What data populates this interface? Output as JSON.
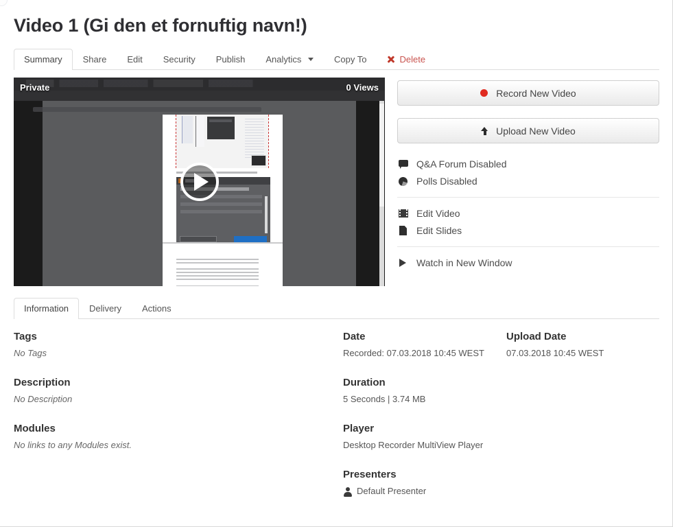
{
  "page": {
    "title": "Video 1 (Gi den et fornuftig navn!)"
  },
  "primary_tabs": [
    {
      "label": "Summary",
      "active": true
    },
    {
      "label": "Share",
      "active": false
    },
    {
      "label": "Edit",
      "active": false
    },
    {
      "label": "Security",
      "active": false
    },
    {
      "label": "Publish",
      "active": false
    },
    {
      "label": "Analytics",
      "active": false,
      "caret": true
    },
    {
      "label": "Copy To",
      "active": false
    },
    {
      "label": "Delete",
      "active": false,
      "danger": true,
      "icon": "delete-x-icon"
    }
  ],
  "player": {
    "privacy_badge": "Private",
    "views_badge": "0 Views",
    "play_icon": "play-icon"
  },
  "actions": {
    "record_button": {
      "label": "Record New Video",
      "icon": "record-dot-icon"
    },
    "upload_button": {
      "label": "Upload New Video",
      "icon": "upload-arrow-icon"
    },
    "groups": [
      {
        "items": [
          {
            "label": "Q&A Forum Disabled",
            "icon": "speech-bubble-icon"
          },
          {
            "label": "Polls Disabled",
            "icon": "pie-chart-icon"
          }
        ]
      },
      {
        "items": [
          {
            "label": "Edit Video",
            "icon": "film-strip-icon"
          },
          {
            "label": "Edit Slides",
            "icon": "document-icon"
          }
        ]
      },
      {
        "items": [
          {
            "label": "Watch in New Window",
            "icon": "play-triangle-icon"
          }
        ]
      }
    ]
  },
  "lower_tabs": [
    {
      "label": "Information",
      "active": true
    },
    {
      "label": "Delivery",
      "active": false
    },
    {
      "label": "Actions",
      "active": false
    }
  ],
  "info": {
    "column_1": [
      {
        "heading": "Tags",
        "value": "No Tags",
        "muted": true
      },
      {
        "heading": "Description",
        "value": "No Description",
        "muted": true
      },
      {
        "heading": "Modules",
        "value": "No links to any Modules exist.",
        "muted": true
      }
    ],
    "column_2": [
      {
        "heading": "Date",
        "value": "Recorded: 07.03.2018 10:45 WEST",
        "muted": false
      },
      {
        "heading": "Duration",
        "value": "5 Seconds | 3.74 MB",
        "muted": false
      },
      {
        "heading": "Player",
        "value": "Desktop Recorder MultiView Player",
        "muted": false
      },
      {
        "heading": "Presenters",
        "value": "Default Presenter",
        "muted": false,
        "icon": "user-icon"
      }
    ],
    "column_3": [
      {
        "heading": "Upload Date",
        "value": "07.03.2018 10:45 WEST",
        "muted": false
      }
    ]
  },
  "colors": {
    "danger": "#c9544f",
    "record_dot": "#e02b20",
    "heading": "#333333",
    "tab_border": "#dddddd"
  }
}
